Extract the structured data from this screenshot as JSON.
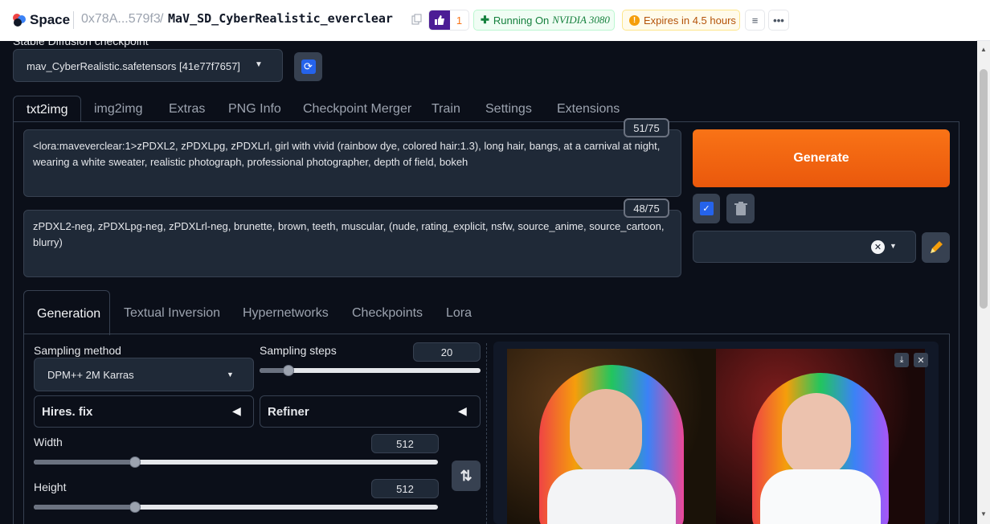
{
  "header": {
    "brand": "Space",
    "owner": "0x78A...579f3",
    "separator": "/",
    "space_name": "MaV_SD_CyberRealistic_everclear",
    "like_count": "1",
    "running_label": "Running On",
    "hardware": "NVIDIA 3080",
    "expires": "Expires in 4.5 hours"
  },
  "checkpoint": {
    "label": "Stable Diffusion checkpoint",
    "value": "mav_CyberRealistic.safetensors [41e77f7657]"
  },
  "tabs": [
    "txt2img",
    "img2img",
    "Extras",
    "PNG Info",
    "Checkpoint Merger",
    "Train",
    "Settings",
    "Extensions"
  ],
  "prompt": {
    "text": "<lora:maveverclear:1>zPDXL2, zPDXLpg, zPDXLrl,  girl with vivid (rainbow dye, colored hair:1.3), long hair, bangs, at a carnival at night, wearing a white sweater, realistic photograph, professional photographer, depth of field, bokeh",
    "tokens": "51/75"
  },
  "negative_prompt": {
    "text": "zPDXL2-neg, zPDXLpg-neg, zPDXLrl-neg, brunette, brown, teeth, muscular, (nude, rating_explicit, nsfw, source_anime, source_cartoon, blurry)",
    "tokens": "48/75"
  },
  "generate_label": "Generate",
  "subtabs": [
    "Generation",
    "Textual Inversion",
    "Hypernetworks",
    "Checkpoints",
    "Lora"
  ],
  "sampling": {
    "method_label": "Sampling method",
    "method_value": "DPM++ 2M Karras",
    "steps_label": "Sampling steps",
    "steps_value": "20",
    "steps_fraction": 0.13
  },
  "accordions": {
    "hires": "Hires. fix",
    "refiner": "Refiner"
  },
  "width": {
    "label": "Width",
    "value": "512",
    "fraction": 0.25
  },
  "height": {
    "label": "Height",
    "value": "512",
    "fraction": 0.25
  },
  "colors": {
    "accent": "#f97316",
    "bg": "#0b0f19",
    "panel": "#1f2937",
    "running": "#16a34a",
    "expires": "#d97706"
  }
}
